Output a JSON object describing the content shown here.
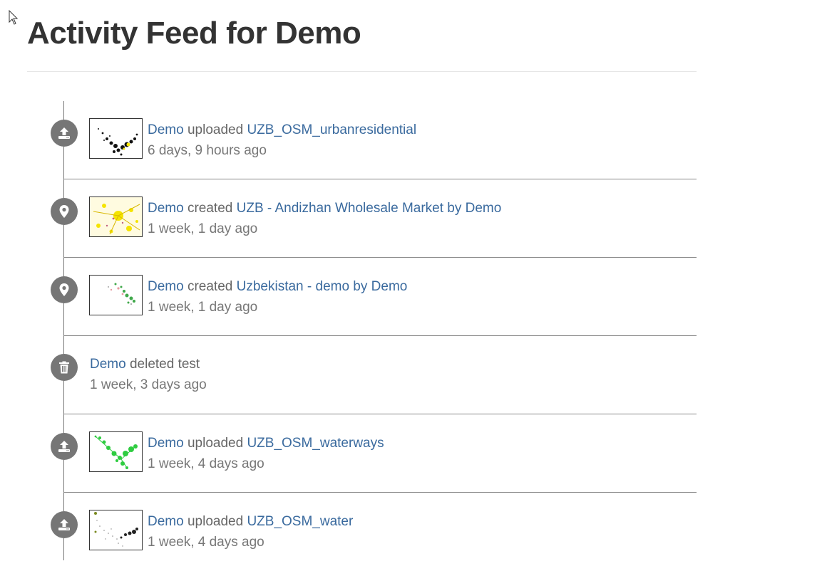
{
  "page": {
    "title": "Activity Feed for Demo"
  },
  "feed": [
    {
      "icon": "upload-icon",
      "actor": "Demo",
      "verb": "uploaded",
      "object": "UZB_OSM_urbanresidential",
      "time": "6 days, 9 hours ago",
      "thumb_color": "#f5e400"
    },
    {
      "icon": "map-marker-icon",
      "actor": "Demo",
      "verb": "created",
      "object": "UZB - Andizhan Wholesale Market by Demo",
      "time": "1 week, 1 day ago",
      "thumb_color": "#f5e400"
    },
    {
      "icon": "map-marker-icon",
      "actor": "Demo",
      "verb": "created",
      "object": "Uzbekistan - demo by Demo",
      "time": "1 week, 1 day ago",
      "thumb_color": "#3fa84a"
    },
    {
      "icon": "trash-icon",
      "actor": "Demo",
      "verb": "deleted test",
      "object": "",
      "time": "1 week, 3 days ago"
    },
    {
      "icon": "upload-icon",
      "actor": "Demo",
      "verb": "uploaded",
      "object": "UZB_OSM_waterways",
      "time": "1 week, 4 days ago",
      "thumb_color": "#2ecc40"
    },
    {
      "icon": "upload-icon",
      "actor": "Demo",
      "verb": "uploaded",
      "object": "UZB_OSM_water",
      "time": "1 week, 4 days ago",
      "thumb_color": "#333333"
    }
  ],
  "colors": {
    "link": "#3a6a9e",
    "badge": "#767676",
    "text": "#666666"
  }
}
